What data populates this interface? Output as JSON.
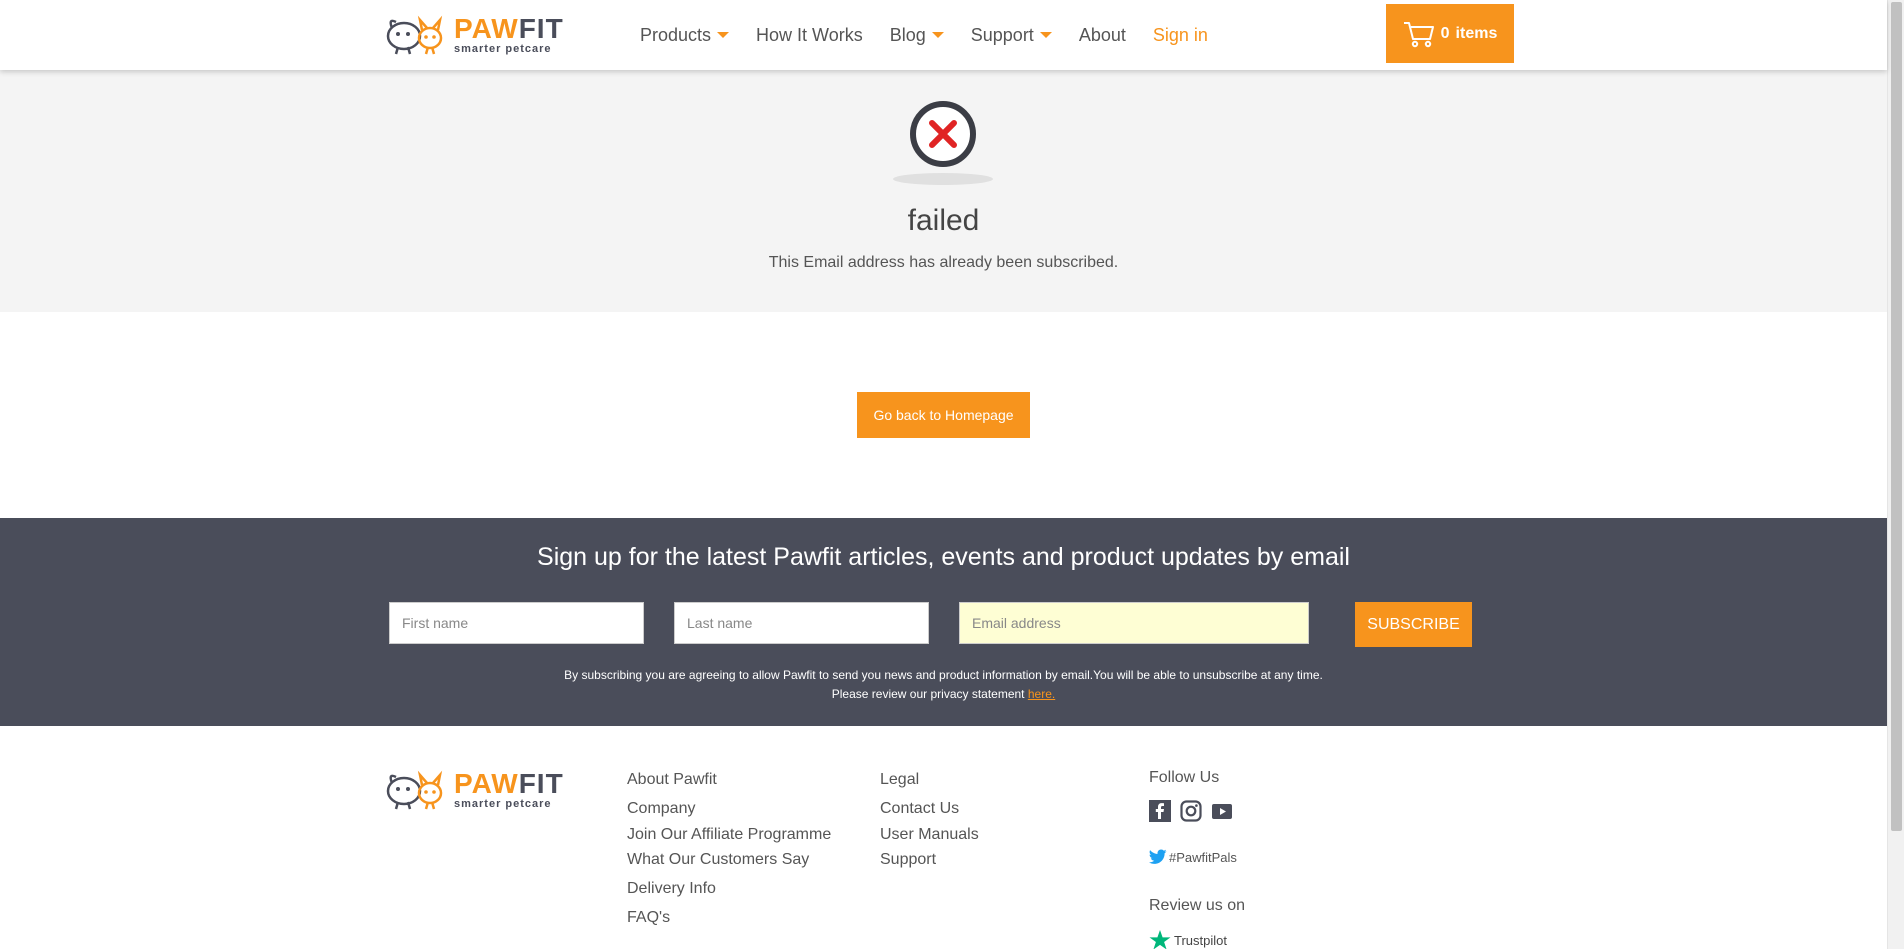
{
  "header": {
    "logo": {
      "word_a": "PAW",
      "word_b": "FIT",
      "tagline": "smarter petcare"
    },
    "nav": [
      {
        "label": "Products",
        "has_dropdown": true
      },
      {
        "label": "How It Works",
        "has_dropdown": false
      },
      {
        "label": "Blog",
        "has_dropdown": true
      },
      {
        "label": "Support",
        "has_dropdown": true
      },
      {
        "label": "About",
        "has_dropdown": false
      },
      {
        "label": "Sign in",
        "has_dropdown": false
      }
    ],
    "cart": {
      "count": "0",
      "label": "items",
      "icon": "cart-icon"
    }
  },
  "status": {
    "icon": "error-x-icon",
    "title": "failed",
    "message": "This Email address has already been subscribed."
  },
  "home_button": "Go back to Homepage",
  "newsletter": {
    "title": "Sign up for the latest Pawfit articles, events and product updates by email",
    "first_name_placeholder": "First name",
    "last_name_placeholder": "Last name",
    "email_placeholder": "Email address",
    "subscribe_label": "SUBSCRIBE",
    "legal_line1": "By subscribing you are agreeing to allow Pawfit to send you news and product information by email.You will be able to unsubscribe at any time.",
    "legal_line2": "Please review our privacy statement",
    "legal_link": "here."
  },
  "footer": {
    "col1": [
      "About Pawfit",
      "Company",
      "Join Our Affiliate Programme",
      "What Our Customers Say",
      "Delivery Info",
      "FAQ's"
    ],
    "col2": [
      "Legal",
      "Contact Us",
      "User Manuals",
      "Support"
    ],
    "follow_title": "Follow Us",
    "social_icons": [
      "facebook-icon",
      "instagram-icon",
      "youtube-icon"
    ],
    "hashtag": "#PawfitPals",
    "review_title": "Review us on",
    "review_site": "Trustpilot"
  },
  "colors": {
    "accent": "#f7941d",
    "dark": "#4a4d5a",
    "panel": "#f4f4f4",
    "error": "#e02424",
    "trustpilot": "#00b67a",
    "twitter": "#1da1f2"
  }
}
